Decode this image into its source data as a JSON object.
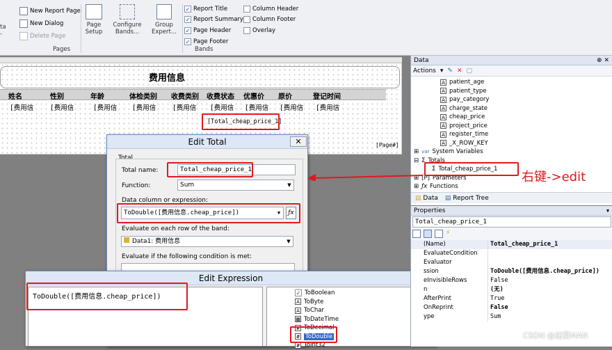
{
  "ribbon": {
    "new_report_page": "New Report Page",
    "new_dialog": "New Dialog",
    "delete_page": "Delete Page",
    "pages_group": "Pages",
    "page_setup_line1": "Page",
    "page_setup_line2": "Setup",
    "configure_bands_line1": "Configure",
    "configure_bands_line2": "Bands...",
    "group_expert_line1": "Group",
    "group_expert_line2": "Expert...",
    "report_title": "Report Title",
    "report_summary": "Report Summary",
    "page_header": "Page Header",
    "page_footer": "Page Footer",
    "column_header": "Column Header",
    "column_footer": "Column Footer",
    "overlay": "Overlay",
    "bands_group": "Bands",
    "left_cut_1": "ta",
    "left_cut_2": "-"
  },
  "designer": {
    "report_title": "费用信息",
    "headers": [
      "姓名",
      "性别",
      "年龄",
      "体检类别",
      "收费类别",
      "收费状态",
      "优惠价",
      "原价",
      "登记时间"
    ],
    "cell_text": "[费用信",
    "total_text": "[Total_cheap_price_1]",
    "page_text": "[Page#]"
  },
  "edit_total": {
    "title": "Edit Total",
    "group_label": "Total",
    "total_name_label": "Total name:",
    "total_name_value": "Total_cheap_price_1",
    "function_label": "Function:",
    "function_value": "Sum",
    "data_column_label": "Data column or expression:",
    "data_column_value": "ToDouble([费用信息.cheap_price])",
    "evaluate_band_label": "Evaluate on each row of the band:",
    "evaluate_band_value": "Data1: 费用信息",
    "condition_label": "Evaluate if the following condition is met:"
  },
  "edit_expression": {
    "title": "Edit Expression",
    "expression": "ToDouble([费用信息.cheap_price])",
    "functions": [
      "ToBoolean",
      "ToByte",
      "ToChar",
      "ToDateTime",
      "ToDecimal",
      "ToDouble",
      "ToInt32"
    ]
  },
  "data_panel": {
    "title": "Data",
    "actions_label": "Actions",
    "fields": [
      "patient_age",
      "patient_type",
      "pay_category",
      "charge_state",
      "cheap_price",
      "project_price",
      "register_time",
      "_X_ROW_KEY"
    ],
    "system_variables": "System Variables",
    "totals": "Totals",
    "total_item": "Total_cheap_price_1",
    "parameters": "Parameters",
    "functions": "Functions",
    "tab_data": "Data",
    "tab_report_tree": "Report Tree",
    "annotation": "右键->edit"
  },
  "properties": {
    "title": "Properties",
    "object": "Total_cheap_price_1",
    "rows": [
      {
        "k": "(Name)",
        "v": "Total_cheap_price_1",
        "bold": true
      },
      {
        "k": "EvaluateCondition",
        "v": "",
        "bold": false
      },
      {
        "k": "Evaluator",
        "v": "",
        "bold": false
      },
      {
        "k": "ssion",
        "v": "ToDouble([费用信息.cheap_price])",
        "bold": true
      },
      {
        "k": "eInvisibleRows",
        "v": "False",
        "bold": false
      },
      {
        "k": "n",
        "v": "(无)",
        "bold": true
      },
      {
        "k": "AfterPrint",
        "v": "True",
        "bold": false
      },
      {
        "k": "OnReprint",
        "v": "False",
        "bold": true
      },
      {
        "k": "ype",
        "v": "Sum",
        "bold": false
      }
    ]
  },
  "watermark": "CSDN @迷雾MAN"
}
